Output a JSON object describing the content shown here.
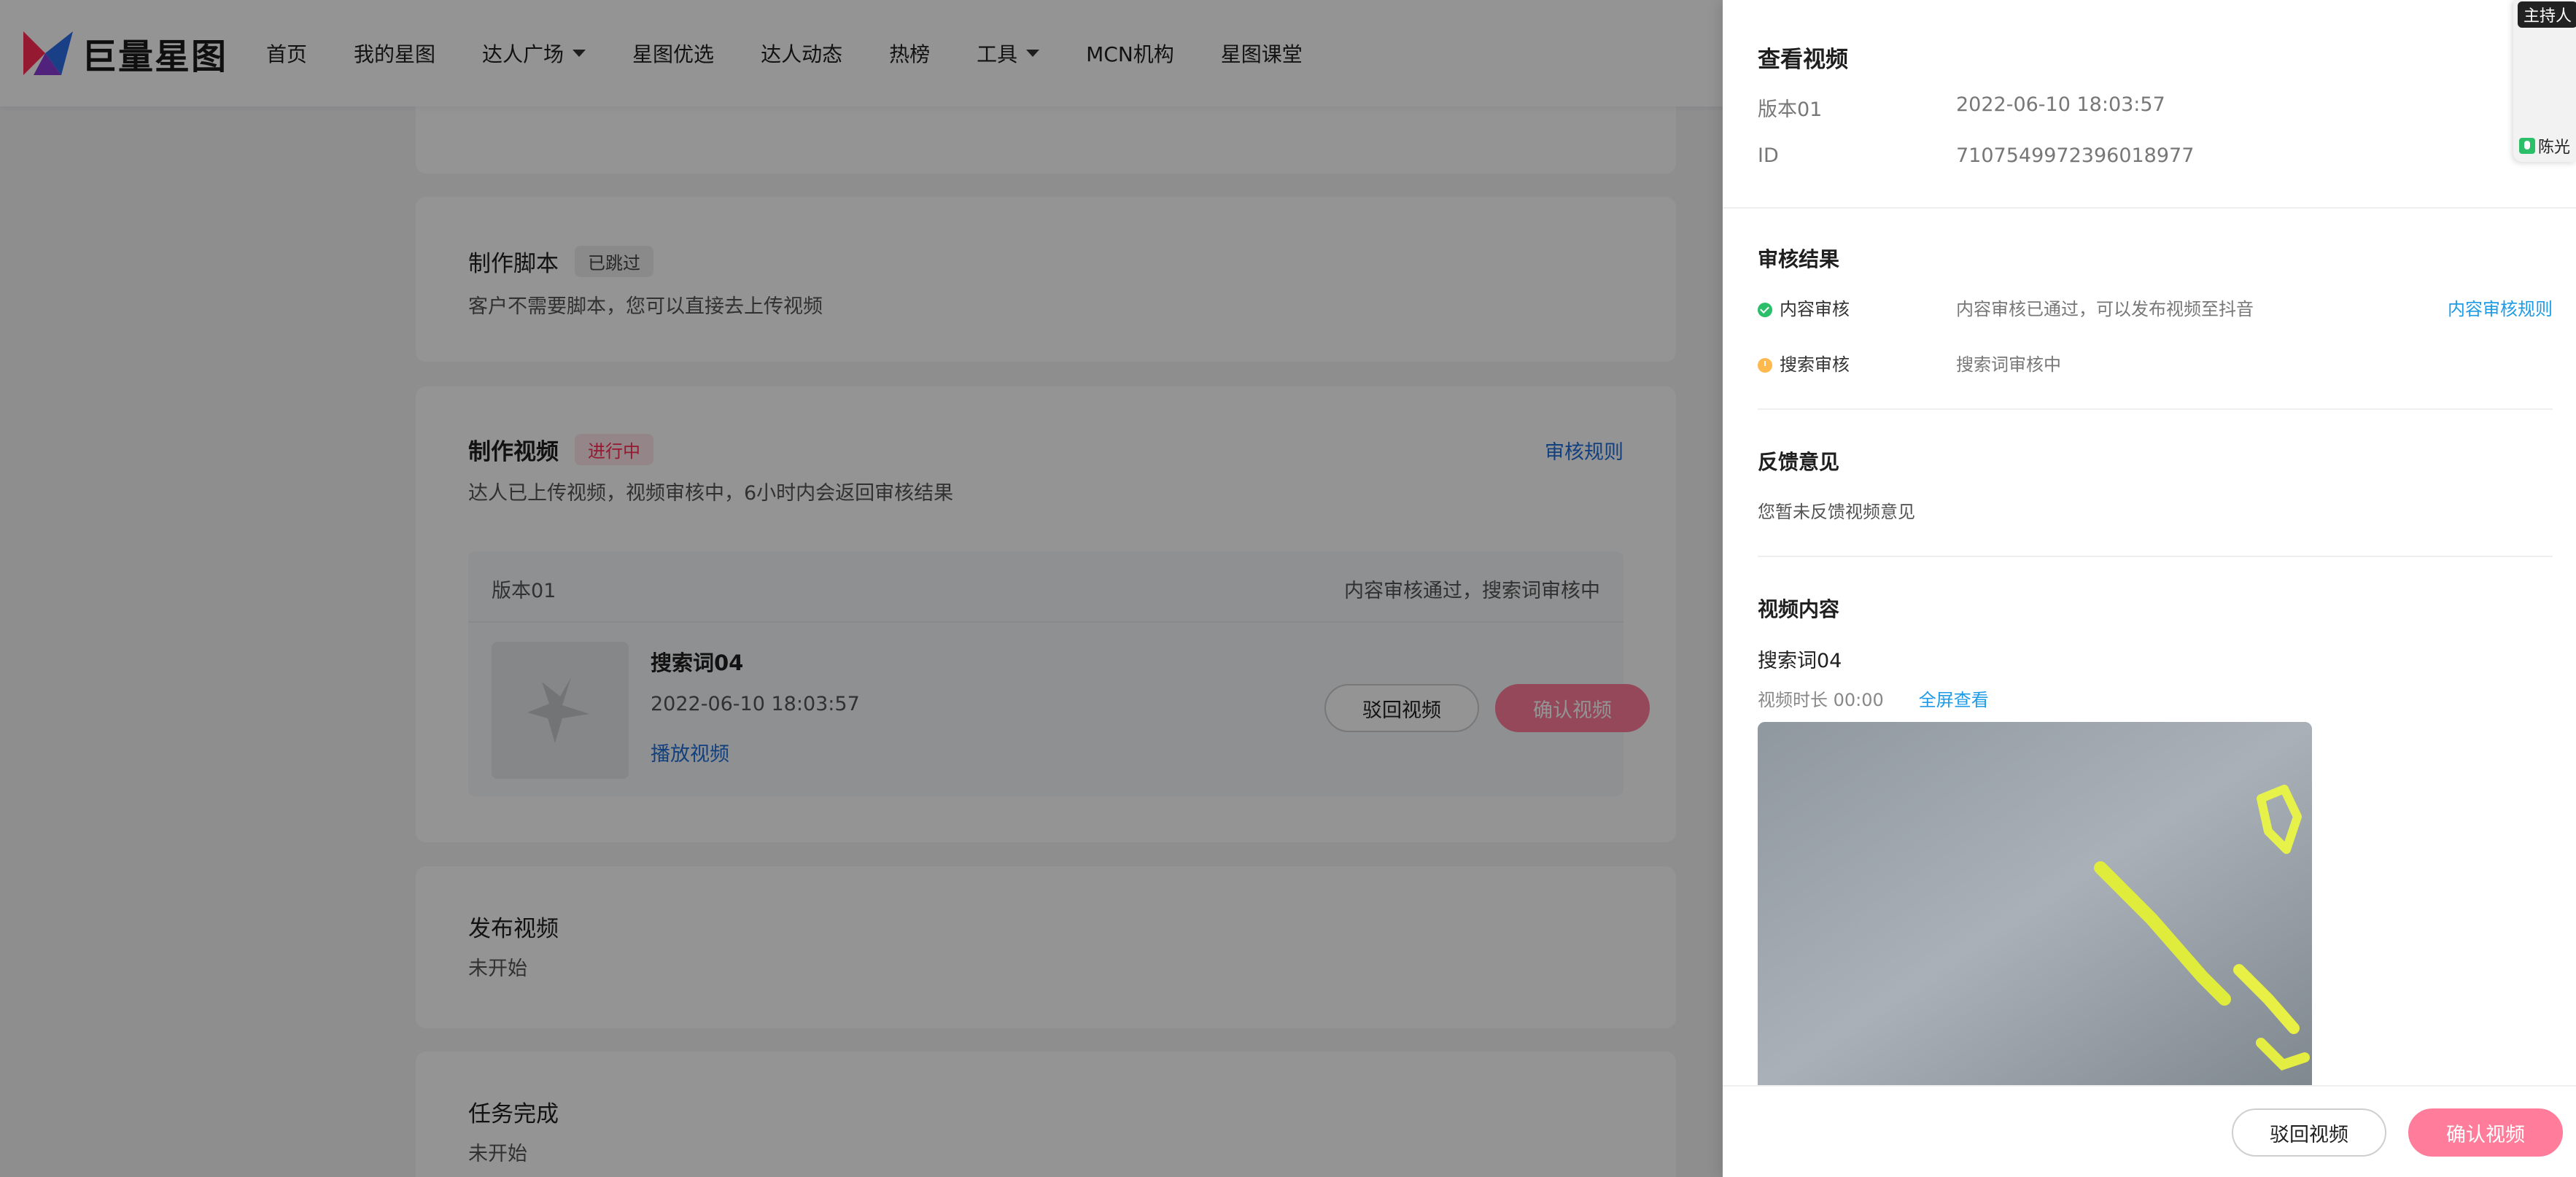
{
  "nav": {
    "logo_text": "巨量星图",
    "items": [
      {
        "label": "首页"
      },
      {
        "label": "我的星图"
      },
      {
        "label": "达人广场"
      },
      {
        "label": "星图优选"
      },
      {
        "label": "达人动态"
      },
      {
        "label": "热榜"
      },
      {
        "label": "工具"
      },
      {
        "label": "MCN机构"
      },
      {
        "label": "星图课堂"
      }
    ]
  },
  "steps": {
    "script": {
      "title": "制作脚本",
      "tag": "已跳过",
      "desc": "客户不需要脚本，您可以直接去上传视频"
    },
    "video": {
      "title": "制作视频",
      "tag": "进行中",
      "rules_link": "审核规则",
      "desc": "达人已上传视频，视频审核中，6小时内会返回审核结果",
      "version": {
        "label": "版本01",
        "status": "内容审核通过，搜索词审核中",
        "name": "搜索词04",
        "date": "2022-06-10 18:03:57",
        "play_link": "播放视频",
        "reject_button": "驳回视频",
        "confirm_button": "确认视频"
      }
    },
    "publish": {
      "title": "发布视频",
      "desc": "未开始"
    },
    "done": {
      "title": "任务完成",
      "desc": "未开始"
    }
  },
  "drawer": {
    "title": "查看视频",
    "version_label": "版本01",
    "version_date": "2022-06-10 18:03:57",
    "id_label": "ID",
    "id_value": "7107549972396018977",
    "review": {
      "title": "审核结果",
      "content": {
        "label": "内容审核",
        "value": "内容审核已通过，可以发布视频至抖音",
        "link": "内容审核规则",
        "status_color": "#2bbf6a"
      },
      "search": {
        "label": "搜索审核",
        "value": "搜索词审核中",
        "status_color": "#ffb84d"
      }
    },
    "feedback": {
      "title": "反馈意见",
      "text": "您暂未反馈视频意见"
    },
    "video": {
      "title": "视频内容",
      "name": "搜索词04",
      "duration": "视频时长 00:00",
      "fullscreen_link": "全屏查看"
    },
    "footer": {
      "reject_button": "驳回视频",
      "confirm_button": "确认视频"
    }
  },
  "presenter": {
    "badge": "主持人",
    "name": "陈光"
  },
  "colors": {
    "brand_pink": "#ff7d9a",
    "link_blue": "#1f6fdb",
    "status_red": "#ff2b55"
  }
}
